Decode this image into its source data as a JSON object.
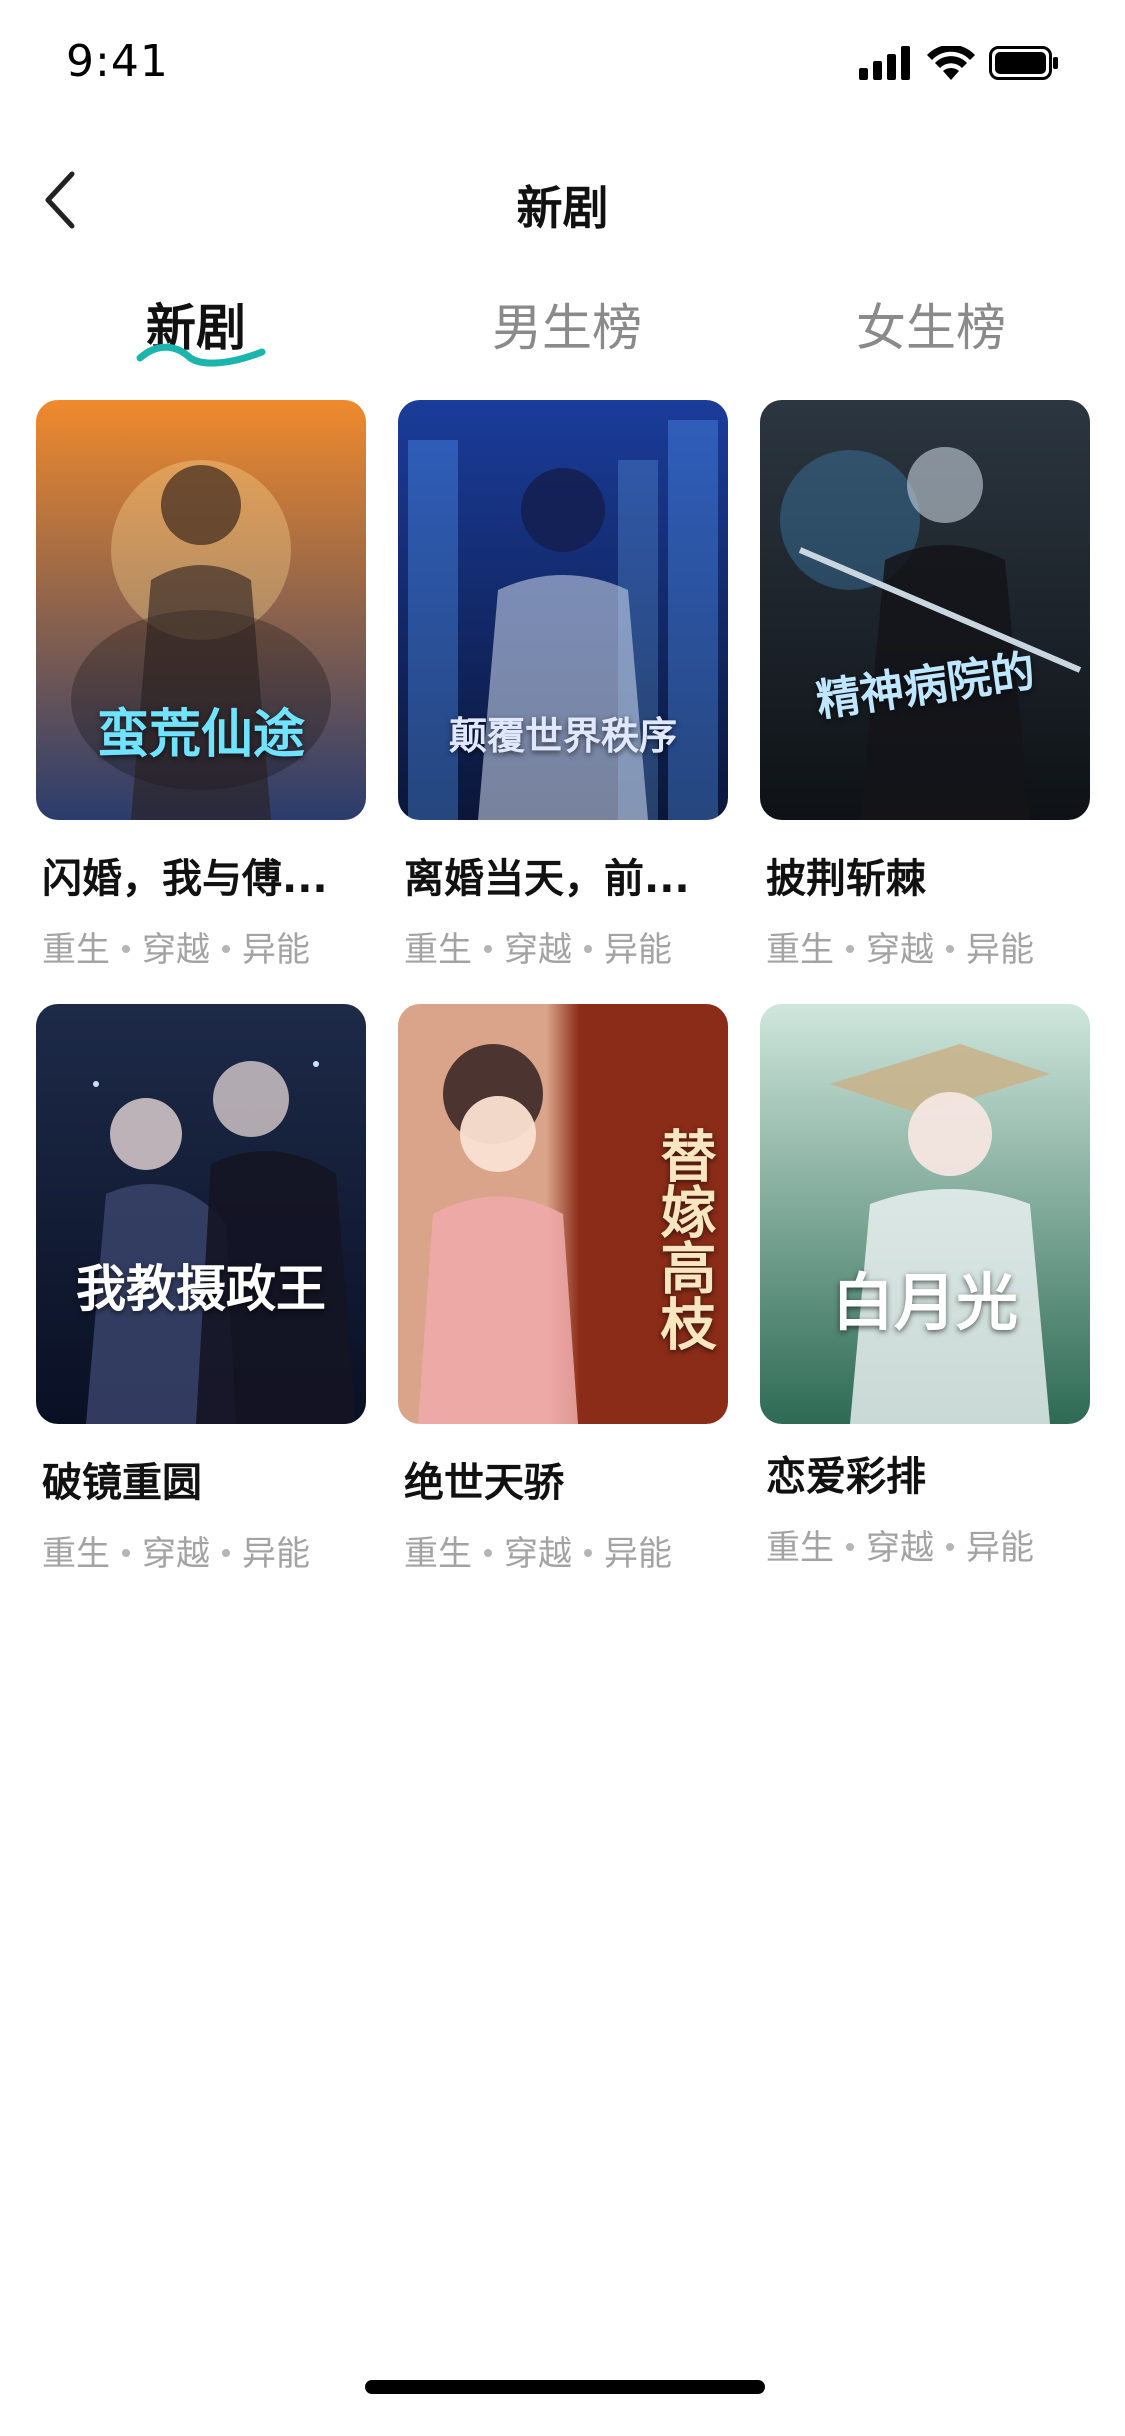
{
  "status_bar": {
    "time": "9:41"
  },
  "nav": {
    "title": "新剧"
  },
  "tabs": [
    {
      "label": "新剧",
      "active": true
    },
    {
      "label": "男生榜",
      "active": false
    },
    {
      "label": "女生榜",
      "active": false
    }
  ],
  "accent_color": "#1bb5ad",
  "books": [
    {
      "title": "闪婚，我与傅...",
      "tags": [
        "重生",
        "穿越",
        "异能"
      ],
      "cover_text": "蛮荒仙途",
      "cover_bg": [
        "#f08a2c",
        "#2a3c6c"
      ],
      "cover_text_color": "#6fe3ff"
    },
    {
      "title": "离婚当天，前...",
      "tags": [
        "重生",
        "穿越",
        "异能"
      ],
      "cover_text": "颠覆世界秩序",
      "cover_bg": [
        "#1a3c9a",
        "#0b1638"
      ],
      "cover_text_color": "#dfe8ff"
    },
    {
      "title": "披荆斩棘",
      "tags": [
        "重生",
        "穿越",
        "异能"
      ],
      "cover_text": "精神病院的",
      "cover_bg": [
        "#2c3640",
        "#0e1216"
      ],
      "cover_text_color": "#bfe6ff"
    },
    {
      "title": "破镜重圆",
      "tags": [
        "重生",
        "穿越",
        "异能"
      ],
      "cover_text": "我教摄政王",
      "cover_bg": [
        "#1d2a48",
        "#0a1024"
      ],
      "cover_text_color": "#ffffff"
    },
    {
      "title": "绝世天骄",
      "tags": [
        "重生",
        "穿越",
        "异能"
      ],
      "cover_text": "替嫁高枝",
      "cover_bg": [
        "#d9a48a",
        "#8a2c18"
      ],
      "cover_text_color": "#f7e6c0"
    },
    {
      "title": "恋爱彩排",
      "tags": [
        "重生",
        "穿越",
        "异能"
      ],
      "cover_text": "白月光",
      "cover_bg": [
        "#cfe6dc",
        "#2e6a55"
      ],
      "cover_text_color": "#ffffff"
    }
  ]
}
